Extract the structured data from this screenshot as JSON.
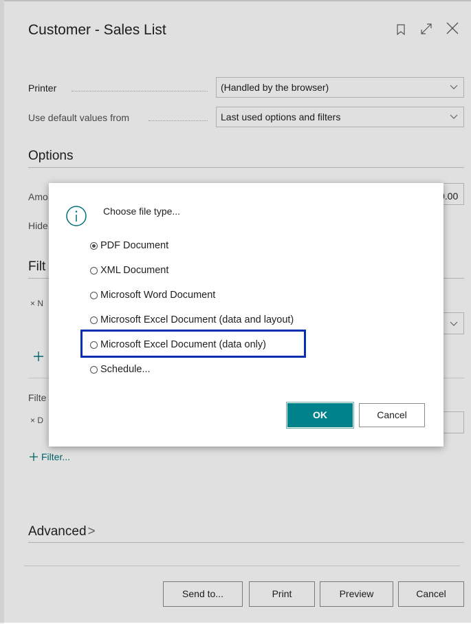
{
  "header": {
    "title": "Customer - Sales List"
  },
  "printer": {
    "label": "Printer",
    "value": "(Handled by the browser)"
  },
  "defaults": {
    "label": "Use default values from",
    "value": "Last used options and filters"
  },
  "options": {
    "title": "Options",
    "amount_label_partial": "Amo",
    "amount_value_partial": "0.00",
    "hide_label_partial": "Hide"
  },
  "filters": {
    "title_partial": "Filt",
    "item_partial": "× N",
    "filter2_partial": "Filte",
    "item2_partial": "× D",
    "add_filter": "Filter..."
  },
  "advanced": {
    "title": "Advanced",
    "chevron": ">"
  },
  "dialog": {
    "title": "Choose file type...",
    "options": [
      {
        "label": "PDF Document",
        "checked": true
      },
      {
        "label": "XML Document",
        "checked": false
      },
      {
        "label": "Microsoft Word Document",
        "checked": false
      },
      {
        "label": "Microsoft Excel Document (data and layout)",
        "checked": false
      },
      {
        "label": "Microsoft Excel Document (data only)",
        "checked": false
      },
      {
        "label": "Schedule...",
        "checked": false
      }
    ],
    "ok_label": "OK",
    "cancel_label": "Cancel"
  },
  "footer": {
    "send_to": "Send to...",
    "print": "Print",
    "preview": "Preview",
    "cancel": "Cancel"
  },
  "colors": {
    "accent": "#00828c",
    "highlight": "#0a2eb0"
  }
}
